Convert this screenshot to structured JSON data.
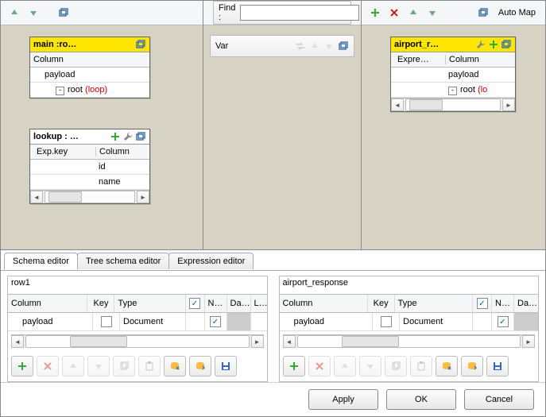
{
  "top": {
    "left": {
      "nodes": {
        "main": {
          "title": "main :ro…",
          "header": "Column",
          "rows": [
            "payload"
          ],
          "tree_label": "root",
          "loop": "(loop)"
        },
        "lookup": {
          "title": "lookup : …",
          "headers": {
            "exp": "Exp.key",
            "col": "Column"
          },
          "rows": [
            "id",
            "name"
          ]
        }
      }
    },
    "mid": {
      "find_label": "Find :",
      "find_value": "",
      "var_label": "Var"
    },
    "right": {
      "automap": "Auto Map",
      "node": {
        "title": "airport_r…",
        "headers": {
          "exp": "Expre…",
          "col": "Column"
        },
        "rows": [
          "payload"
        ],
        "tree_label": "root",
        "loop": "(lo"
      }
    }
  },
  "tabs": {
    "schema": "Schema editor",
    "tree": "Tree schema editor",
    "expr": "Expression editor"
  },
  "editors": {
    "left": {
      "title": "row1",
      "cols": {
        "column": "Column",
        "key": "Key",
        "type": "Type",
        "nullable": "N…",
        "date": "Da…",
        "len": "L…"
      },
      "row": {
        "column": "payload",
        "type": "Document"
      }
    },
    "right": {
      "title": "airport_response",
      "cols": {
        "column": "Column",
        "key": "Key",
        "type": "Type",
        "nullable": "N…",
        "date": "Da…"
      },
      "row": {
        "column": "payload",
        "type": "Document"
      }
    }
  },
  "buttons": {
    "apply": "Apply",
    "ok": "OK",
    "cancel": "Cancel"
  },
  "icons": {
    "plus": "plus-icon",
    "delete": "delete-icon",
    "up": "arrow-up-icon",
    "down": "arrow-down-icon",
    "win": "restore-window-icon",
    "wrench": "wrench-icon",
    "swap": "swap-icon",
    "copy": "copy-icon",
    "paste": "paste-icon",
    "import": "import-icon",
    "export": "export-icon",
    "save": "save-icon"
  }
}
